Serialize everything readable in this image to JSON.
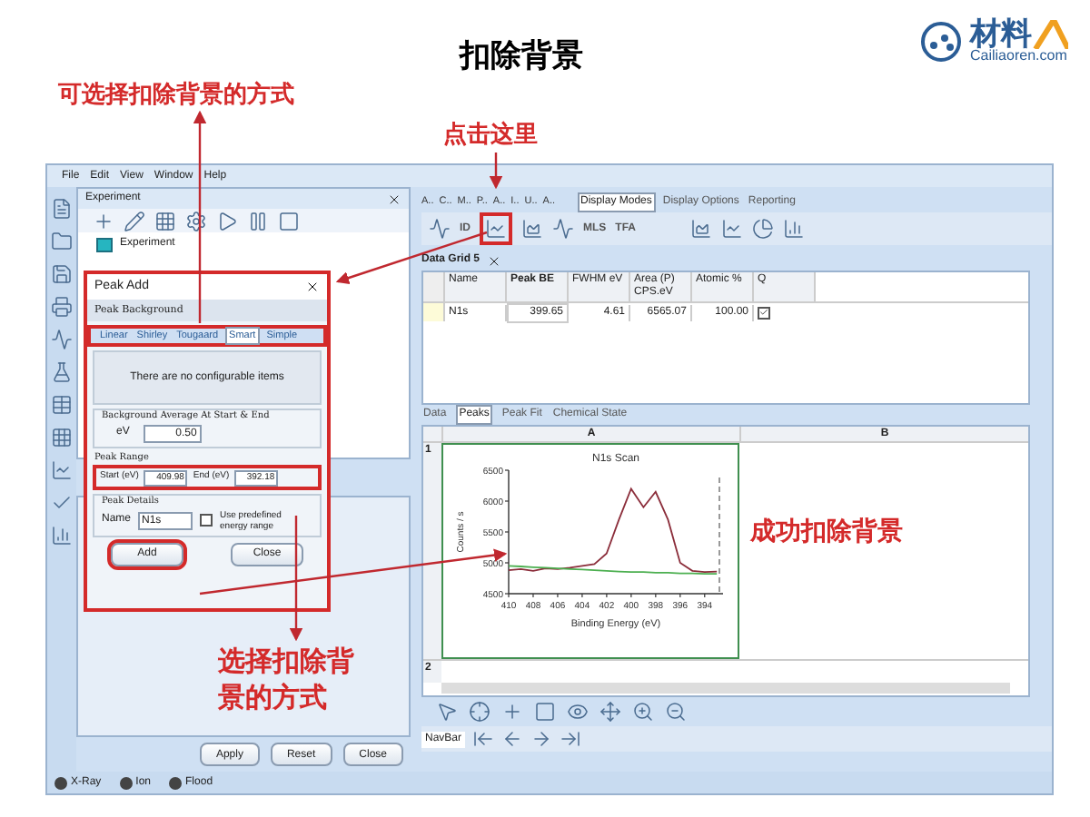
{
  "slide": {
    "title": "扣除背景",
    "logo": {
      "mark": "材料",
      "wordmark": "Cailiaoren",
      "suffix": ".com"
    }
  },
  "annotations": {
    "choose_method": "可选择扣除背景的方式",
    "click_here": "点击这里",
    "success": "成功扣除背景",
    "choose_method_2": "选择扣除背景的方式"
  },
  "menu": [
    "File",
    "Edit",
    "View",
    "Window",
    "Help"
  ],
  "experiment_pane": {
    "title": "Experiment",
    "tree": [
      {
        "label": "Experiment"
      }
    ]
  },
  "peak_add": {
    "title": "Peak Add",
    "section": "Peak Background",
    "tabs": [
      {
        "label": "Linear",
        "selected": false
      },
      {
        "label": "Shirley",
        "selected": false
      },
      {
        "label": "Tougaard",
        "selected": false
      },
      {
        "label": "Smart",
        "selected": true
      },
      {
        "label": "Simple",
        "selected": false
      }
    ],
    "message": "There are no configurable items",
    "bg_average": {
      "legend": "Background Average At Start & End",
      "label": "eV",
      "value": "0.50"
    },
    "range": {
      "legend": "Peak Range",
      "start_label": "Start (eV)",
      "start": "409.98",
      "end_label": "End (eV)",
      "end": "392.18"
    },
    "details": {
      "legend": "Peak Details",
      "name_label": "Name",
      "name": "N1s",
      "predefined": {
        "label": "Use predefined energy range",
        "checked": false
      }
    },
    "buttons": [
      "Add",
      "Close"
    ]
  },
  "footer_buttons": [
    "Apply",
    "Reset",
    "Close"
  ],
  "status": [
    {
      "label": "X-Ray"
    },
    {
      "label": "Ion"
    },
    {
      "label": "Flood"
    }
  ],
  "ribbon": {
    "tabs": [
      "A..",
      "C..",
      "M..",
      "P..",
      "A..",
      "I..",
      "U..",
      "A.."
    ],
    "mode_tabs": [
      {
        "label": "Display Modes",
        "selected": true
      },
      {
        "label": "Display Options",
        "selected": false
      },
      {
        "label": "Reporting",
        "selected": false
      }
    ],
    "tool_labels": [
      "ID",
      "MLS",
      "TFA"
    ]
  },
  "data_grid": {
    "title": "Data Grid 5",
    "columns": [
      "Name",
      "Peak BE",
      "FWHM eV",
      "Area (P) CPS.eV",
      "Atomic %",
      "Q"
    ],
    "rows": [
      {
        "name": "N1s",
        "peak_be": "399.65",
        "fwhm": "4.61",
        "area": "6565.07",
        "atomic": "100.00",
        "checked": true
      }
    ]
  },
  "view_tabs": [
    {
      "label": "Data",
      "selected": false
    },
    {
      "label": "Peaks",
      "selected": true
    },
    {
      "label": "Peak Fit",
      "selected": false
    },
    {
      "label": "Chemical State",
      "selected": false
    }
  ],
  "sheet": {
    "columns": [
      "A",
      "B"
    ],
    "rows": [
      "1",
      "2"
    ],
    "chart_data": {
      "type": "line",
      "title": "N1s Scan",
      "xlabel": "Binding Energy (eV)",
      "ylabel": "Counts / s",
      "x": [
        410,
        409,
        408,
        407,
        406,
        405,
        404,
        403,
        402,
        401,
        400,
        399,
        398,
        397,
        396,
        395,
        394,
        393
      ],
      "series": [
        {
          "color": "#8b2d3a",
          "values": [
            4880,
            4900,
            4870,
            4910,
            4900,
            4920,
            4950,
            4980,
            5150,
            5700,
            6200,
            5900,
            6150,
            5700,
            5000,
            4870,
            4850,
            4860
          ]
        },
        {
          "color": "#4caf50",
          "values": [
            4950,
            4940,
            4930,
            4920,
            4910,
            4900,
            4890,
            4880,
            4870,
            4860,
            4850,
            4850,
            4840,
            4840,
            4830,
            4830,
            4820,
            4820
          ]
        }
      ],
      "xlim": [
        410,
        392.5
      ],
      "ylim": [
        4500,
        6500
      ],
      "xticks": [
        410,
        408,
        406,
        404,
        402,
        400,
        398,
        396,
        394
      ],
      "yticks": [
        4500,
        5000,
        5500,
        6000,
        6500
      ]
    }
  },
  "navbar": {
    "label": "NavBar"
  }
}
